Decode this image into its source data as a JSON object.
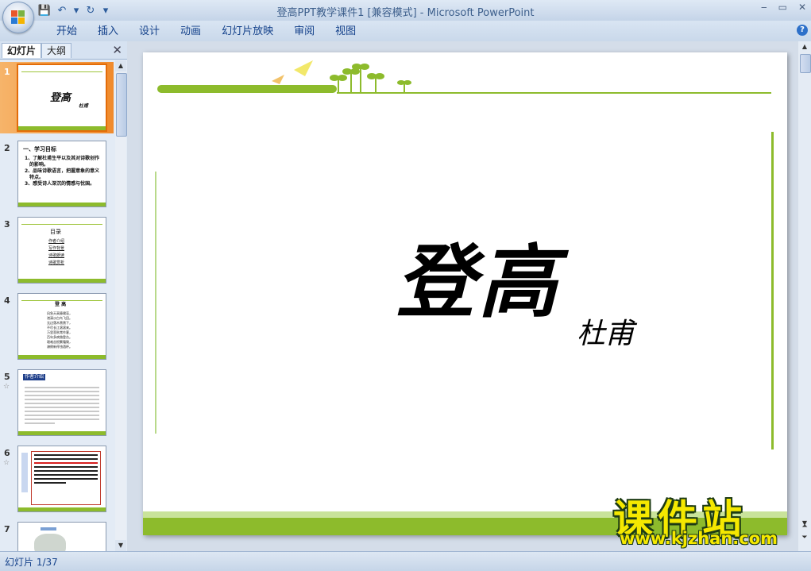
{
  "window": {
    "title": "登高PPT教学课件1 [兼容模式] - Microsoft PowerPoint",
    "controls": [
      "‒",
      "▭",
      "✕"
    ]
  },
  "quick_access": {
    "icons": [
      "save-icon",
      "undo-icon",
      "dropdown-icon",
      "redo-icon",
      "customize-icon"
    ],
    "glyphs": [
      "💾",
      "↶",
      "▾",
      "↻",
      "▾"
    ]
  },
  "ribbon": {
    "tabs": [
      "开始",
      "插入",
      "设计",
      "动画",
      "幻灯片放映",
      "审阅",
      "视图"
    ],
    "help": "?"
  },
  "panel": {
    "tab_slides": "幻灯片",
    "tab_outline": "大纲",
    "close": "✕",
    "thumbnails": [
      {
        "num": "1",
        "title": "登高",
        "subtitle": "杜甫",
        "star": ""
      },
      {
        "num": "2",
        "heading": "一、学习目标",
        "lines": [
          "1、了解杜甫生平以及其对诗歌创作",
          "的影响。",
          "2、品味诗歌语言，把握意象的意义",
          "特点。",
          "3、感受诗人深沉的情感与忧国。"
        ],
        "star": ""
      },
      {
        "num": "3",
        "heading": "目录",
        "lines": [
          "作者介绍",
          "写作背景",
          "诗歌朗读",
          "诗歌赏析"
        ],
        "star": ""
      },
      {
        "num": "4",
        "heading": "登 高",
        "lines": [
          "风急天高猿啸哀，",
          "渚清沙白鸟飞回。",
          "无边落木萧萧下，",
          "不尽长江滚滚来。",
          "万里悲秋常作客，",
          "百年多病独登台。",
          "艰难苦恨繁霜鬓，",
          "潦倒新停浊酒杯。"
        ],
        "star": ""
      },
      {
        "num": "5",
        "heading": "作者介绍",
        "star": "☆"
      },
      {
        "num": "6",
        "star": "☆"
      },
      {
        "num": "7",
        "star": ""
      }
    ]
  },
  "slide": {
    "title": "登高",
    "subtitle": "杜甫"
  },
  "status": {
    "text": "幻灯片 1/37"
  },
  "watermark": {
    "main": "课件站",
    "url": "www.kjzhan.com"
  },
  "colors": {
    "accent_green": "#8dbb2c",
    "selection_orange": "#f08a2c",
    "ribbon_text": "#15428b"
  }
}
